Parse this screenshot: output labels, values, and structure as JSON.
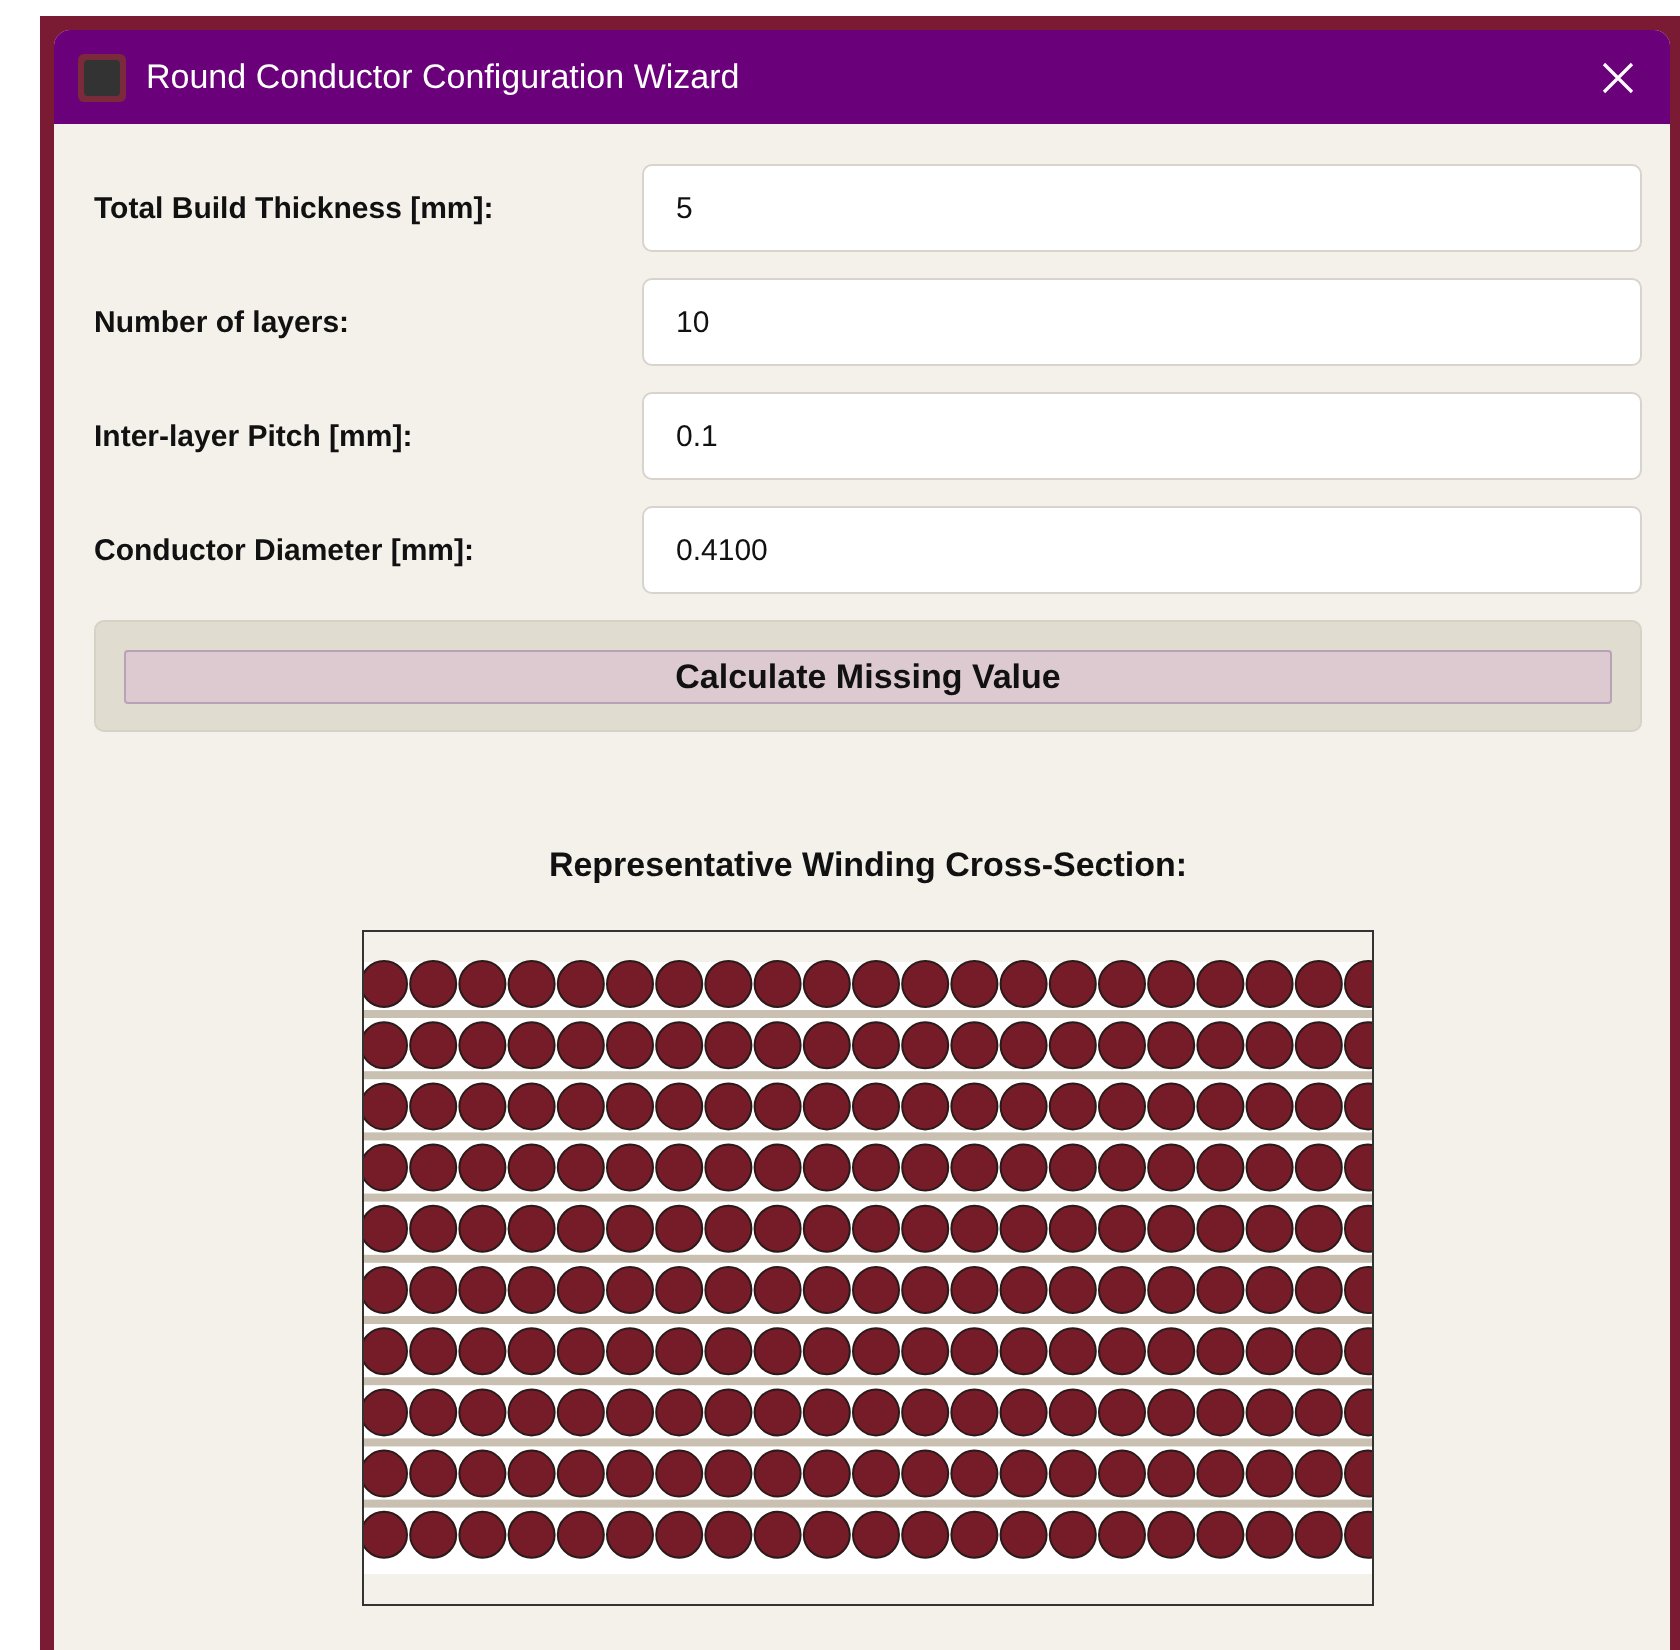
{
  "window": {
    "title": "Round Conductor Configuration Wizard"
  },
  "fields": [
    {
      "label": "Total Build Thickness [mm]:",
      "value": "5"
    },
    {
      "label": "Number of layers:",
      "value": "10"
    },
    {
      "label": "Inter-layer Pitch [mm]:",
      "value": "0.1"
    },
    {
      "label": "Conductor Diameter [mm]:",
      "value": "0.4100"
    }
  ],
  "calculate_button": "Calculate Missing Value",
  "cross_section": {
    "heading": "Representative Winding Cross-Section:"
  }
}
